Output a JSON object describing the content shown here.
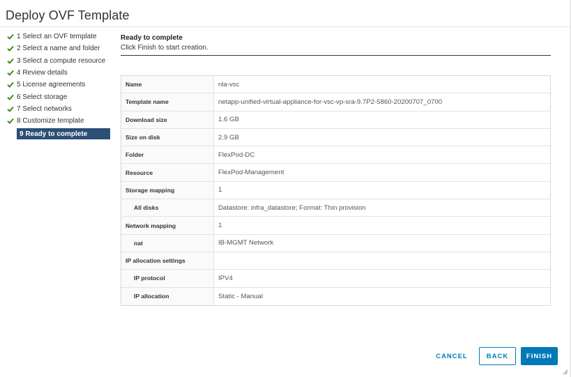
{
  "dialog": {
    "title": "Deploy OVF Template"
  },
  "steps": [
    {
      "label": "1 Select an OVF template",
      "done": true
    },
    {
      "label": "2 Select a name and folder",
      "done": true
    },
    {
      "label": "3 Select a compute resource",
      "done": true
    },
    {
      "label": "4 Review details",
      "done": true
    },
    {
      "label": "5 License agreements",
      "done": true
    },
    {
      "label": "6 Select storage",
      "done": true
    },
    {
      "label": "7 Select networks",
      "done": true
    },
    {
      "label": "8 Customize template",
      "done": true
    },
    {
      "label": "9 Ready to complete",
      "done": false,
      "current": true
    }
  ],
  "content": {
    "title": "Ready to complete",
    "subtitle": "Click Finish to start creation."
  },
  "summary": [
    {
      "label": "Name",
      "value": "nla-vsc"
    },
    {
      "label": "Template name",
      "value": "netapp-unified-virtual-appliance-for-vsc-vp-sra-9.7P2-5860-20200707_0700"
    },
    {
      "label": "Download size",
      "value": "1.6 GB"
    },
    {
      "label": "Size on disk",
      "value": "2.9 GB"
    },
    {
      "label": "Folder",
      "value": "FlexPod-DC"
    },
    {
      "label": "Resource",
      "value": "FlexPod-Management"
    },
    {
      "label": "Storage mapping",
      "value": "1"
    },
    {
      "label": "All disks",
      "value": "Datastore: infra_datastore; Format: Thin provision",
      "indent": true
    },
    {
      "label": "Network mapping",
      "value": "1"
    },
    {
      "label": "nat",
      "value": "IB-MGMT Network",
      "indent": true
    },
    {
      "label": "IP allocation settings",
      "value": ""
    },
    {
      "label": "IP protocol",
      "value": "IPV4",
      "indent": true
    },
    {
      "label": "IP allocation",
      "value": "Static - Manual",
      "indent": true
    }
  ],
  "buttons": {
    "cancel": "CANCEL",
    "back": "BACK",
    "finish": "FINISH"
  },
  "colors": {
    "accent": "#0079b8",
    "step_current_bg": "#2b4f75",
    "check": "#2f8400"
  },
  "icons": {
    "step_done": "check-icon",
    "grip": "resize-grip-icon"
  }
}
